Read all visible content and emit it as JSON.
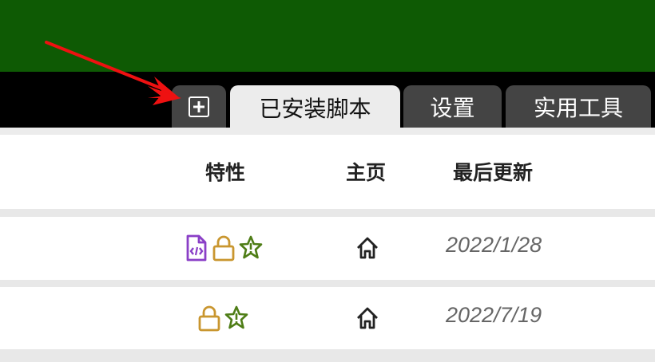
{
  "tabs": {
    "add_icon": "plus-square-icon",
    "installed_label": "已安装脚本",
    "settings_label": "设置",
    "tools_label": "实用工具"
  },
  "columns": {
    "features": "特性",
    "homepage": "主页",
    "last_updated": "最后更新"
  },
  "rows": [
    {
      "feature_icons": [
        "file-code-icon",
        "lock-icon",
        "star-alert-icon"
      ],
      "homepage_icon": "home-icon",
      "last_updated": "2022/1/28"
    },
    {
      "feature_icons": [
        "lock-icon",
        "star-alert-icon"
      ],
      "homepage_icon": "home-icon",
      "last_updated": "2022/7/19"
    }
  ],
  "colors": {
    "header_green": "#0e5a04",
    "tab_bar": "#000000",
    "inactive_tab": "#444444",
    "active_tab": "#ececec",
    "code_icon": "#8a3fc7",
    "lock_icon": "#c9962f",
    "star_icon": "#4e7d16",
    "arrow": "#ee1111"
  }
}
